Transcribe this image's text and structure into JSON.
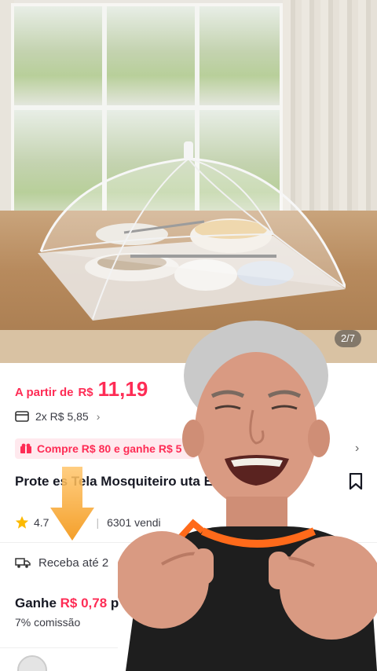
{
  "gallery": {
    "counter": "2/7"
  },
  "product": {
    "price_prefix": "A partir de",
    "currency": "R$",
    "price": "11,19",
    "installments": "2x R$ 5,85",
    "promo": "Compre R$ 80 e ganhe R$ 5",
    "title": "Prote    es Tela Mosquiteiro               uta E Bolo",
    "rating": "4.7",
    "sold": "6301 vendi",
    "delivery": "Receba até 2",
    "earn_prefix": "Ganhe",
    "earn_amount": "R$ 0,78",
    "earn_suffix": "p",
    "commission": "7% comissão"
  },
  "colors": {
    "accent": "#fe2c55",
    "promo_bg": "#ffe9ee",
    "arrow": "#f5a623"
  },
  "icons": [
    "card-icon",
    "chevron-right-icon",
    "gift-icon",
    "bookmark-icon",
    "star-icon",
    "truck-icon",
    "down-arrow-icon"
  ]
}
